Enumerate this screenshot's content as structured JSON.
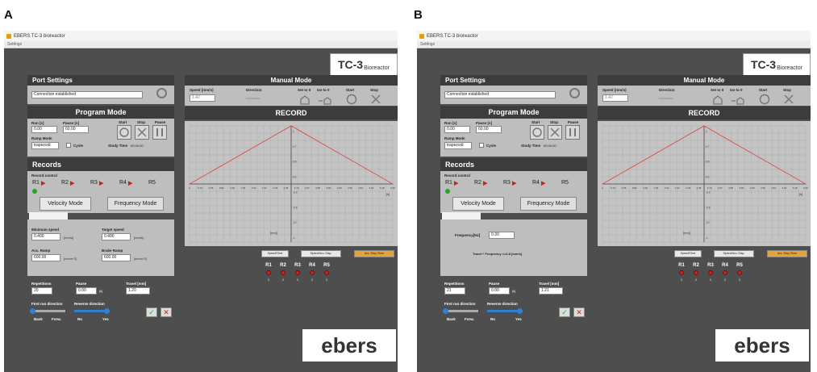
{
  "panels": [
    {
      "label": "A",
      "mode": "velocity"
    },
    {
      "label": "B",
      "mode": "frequency"
    }
  ],
  "window": {
    "title": "EBERS TC-3 bioreactor",
    "menu": "Settings"
  },
  "logo": {
    "tc": "TC-3",
    "brand": "Bioreactor"
  },
  "port": {
    "title": "Port Settings",
    "status": "Connection established"
  },
  "manual": {
    "title": "Manual Mode",
    "speed_label": "Speed [mm/s]",
    "speed_value": "1.42",
    "direction_label": "Direction",
    "direction_value": "backward",
    "setto0": "Set to 0",
    "goto0": "Go to 0",
    "start": "Start",
    "stop": "Stop"
  },
  "program": {
    "title": "Program Mode",
    "run_label": "Run [s]",
    "run_value": "0.00",
    "pause_label": "Pause [s]",
    "pause_value": "60.00",
    "start": "Start",
    "stop": "Stop",
    "pause": "Pause",
    "ramp_label": "Ramp Mode",
    "ramp_value": "trapezoid",
    "cycle": "Cycle",
    "study_label": "Study Time",
    "study_value": "00:00:00"
  },
  "records": {
    "title": "Records",
    "record_control": "Record control",
    "items": [
      "R1",
      "R2",
      "R3",
      "R4",
      "R5"
    ],
    "velocity_tab": "Velocity Mode",
    "frequency_tab": "Frequency Mode"
  },
  "velocity": {
    "min_label": "Minimum speed",
    "min_value": "0.400",
    "min_unit": "[mm/s]",
    "target_label": "Target speed",
    "target_value": "0.400",
    "target_unit": "[mm/s]",
    "acc_label": "Acc. Ramp",
    "acc_value": "600.00",
    "acc_unit": "[mm/s^2]",
    "brake_label": "Brake Ramp",
    "brake_value": "600.00",
    "brake_unit": "[mm/s^2]"
  },
  "frequency": {
    "label": "Frequency[Hz]",
    "value": "0.30",
    "note": "Travel * Frequency <=0.8 [mm/s]"
  },
  "bottom": {
    "rep_label": "Repetitions",
    "rep_value_a": "20",
    "rep_value_b": "21",
    "pause_label": "Pause",
    "pause_value": "0.00",
    "pause_unit": "[s]",
    "travel_label": "Travel [mm]",
    "travel_value_a": "1.20",
    "travel_value_b": "1.21",
    "first_dir": "First run direction",
    "rev_dir": "Reverse direction",
    "back": "Back",
    "forw": "Forw.",
    "no": "No",
    "yes": "Yes",
    "ok": "✓",
    "cancel": "✕"
  },
  "record": {
    "title": "RECORD",
    "btn_speed_time": "Speed/Time",
    "btn_speed_acc": "Speed/Acc. Disp.",
    "btn_acc_disp": "Acc. Disp./Time",
    "values_a": [
      "0",
      "0",
      "0",
      "0",
      "0"
    ],
    "values_b": [
      "0",
      "0",
      "0",
      "0",
      "0"
    ]
  },
  "chart_data": {
    "type": "line",
    "x": [
      0,
      2.73,
      5.46
    ],
    "y": [
      0,
      1,
      0
    ],
    "xlim": [
      0,
      5.46
    ],
    "ylim": [
      -1,
      1
    ],
    "xlabel": "[s]",
    "ylabel": "[mm]",
    "series_color": "#d9534f",
    "grid": true,
    "xticks": [
      "0",
      "0.27",
      "0.55",
      "0.82",
      "1.09",
      "1.36",
      "1.64",
      "1.91",
      "2.18",
      "2.46",
      "2.73",
      "3.27",
      "3.55",
      "3.82",
      "4.09",
      "4.36",
      "4.64",
      "4.91",
      "5.18",
      "5.46"
    ],
    "yticks": [
      "1",
      "0.7",
      "0.5",
      "0.2",
      "-0.2",
      "-0.5",
      "-0.7",
      "-1"
    ]
  },
  "ebers_text": "ebers"
}
